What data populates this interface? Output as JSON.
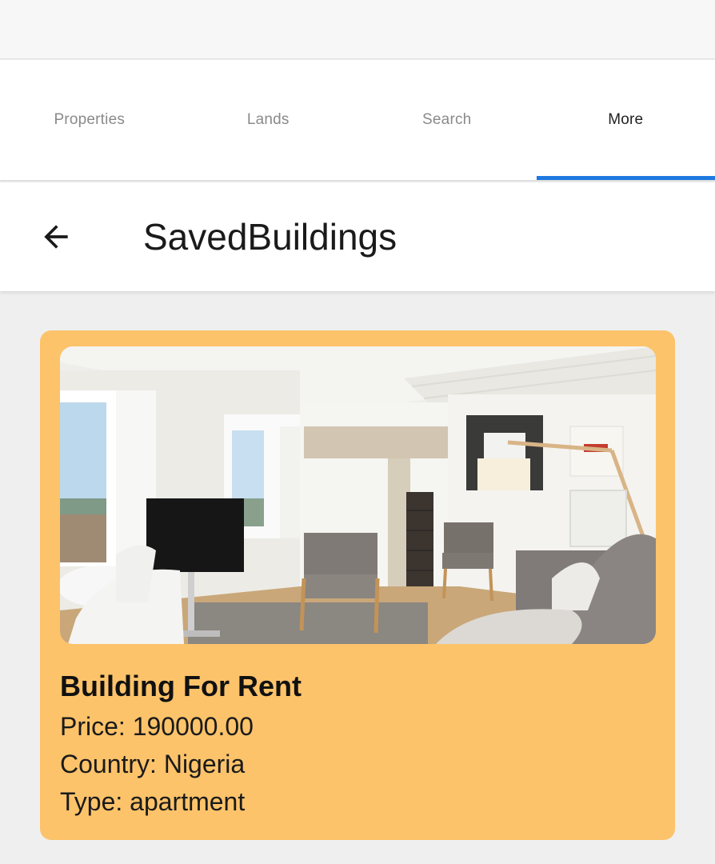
{
  "tabs": [
    {
      "label": "Properties",
      "active": false
    },
    {
      "label": "Lands",
      "active": false
    },
    {
      "label": "Search",
      "active": false
    },
    {
      "label": "More",
      "active": true
    }
  ],
  "colors": {
    "accent": "#1e78e0",
    "card_background": "#fdc36a",
    "page_background": "#efefef"
  },
  "header": {
    "back_icon": "arrow-left-icon",
    "title": "SavedBuildings"
  },
  "saved_buildings": [
    {
      "image": "living-room-photo",
      "title": "Building For Rent",
      "price": "Price: 190000.00",
      "country": "Country: Nigeria",
      "type": "Type: apartment"
    }
  ]
}
